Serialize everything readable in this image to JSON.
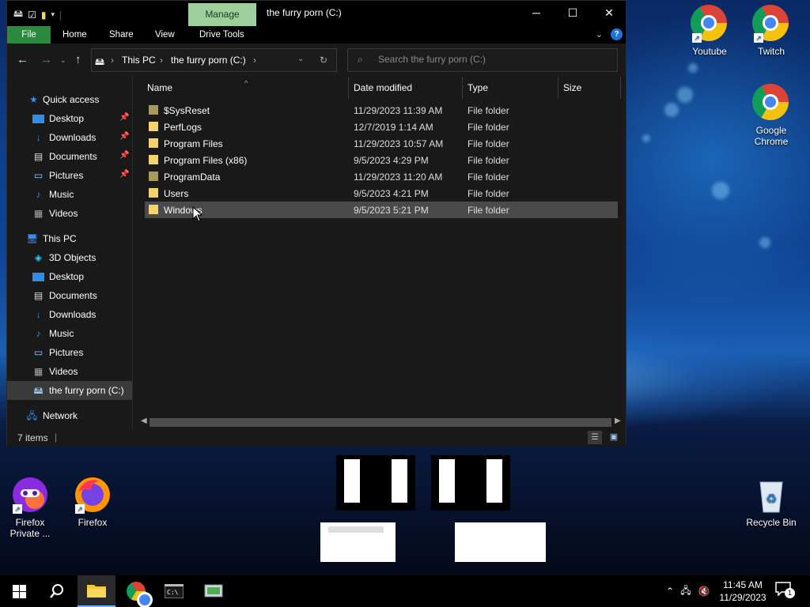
{
  "window": {
    "title": "the furry porn (C:)",
    "manage_label": "Manage",
    "tabs": [
      "File",
      "Home",
      "Share",
      "View",
      "Drive Tools"
    ]
  },
  "address": {
    "crumbs": [
      "This PC",
      "the furry porn (C:)"
    ],
    "search_placeholder": "Search the furry porn (C:)"
  },
  "nav": {
    "quick_access": "Quick access",
    "quick_items": [
      "Desktop",
      "Downloads",
      "Documents",
      "Pictures",
      "Music",
      "Videos"
    ],
    "this_pc": "This PC",
    "pc_items": [
      "3D Objects",
      "Desktop",
      "Documents",
      "Downloads",
      "Music",
      "Pictures",
      "Videos",
      "the furry porn (C:)"
    ],
    "network": "Network"
  },
  "columns": [
    "Name",
    "Date modified",
    "Type",
    "Size"
  ],
  "files": [
    {
      "name": "$SysReset",
      "date": "11/29/2023 11:39 AM",
      "type": "File folder"
    },
    {
      "name": "PerfLogs",
      "date": "12/7/2019 1:14 AM",
      "type": "File folder"
    },
    {
      "name": "Program Files",
      "date": "11/29/2023 10:57 AM",
      "type": "File folder"
    },
    {
      "name": "Program Files (x86)",
      "date": "9/5/2023 4:29 PM",
      "type": "File folder"
    },
    {
      "name": "ProgramData",
      "date": "11/29/2023 11:20 AM",
      "type": "File folder"
    },
    {
      "name": "Users",
      "date": "9/5/2023 4:21 PM",
      "type": "File folder"
    },
    {
      "name": "Windows",
      "date": "9/5/2023 5:21 PM",
      "type": "File folder"
    }
  ],
  "status": {
    "items_count": "7 items"
  },
  "desktop_icons": {
    "youtube": "Youtube",
    "twitch": "Twitch",
    "chrome": "Google Chrome",
    "firefox_private": "Firefox Private ...",
    "firefox": "Firefox",
    "recycle": "Recycle Bin"
  },
  "taskbar": {
    "time": "11:45 AM",
    "date": "11/29/2023",
    "notif_count": "1"
  },
  "colors": {
    "accent_green": "#2b8a3e",
    "manage_tab": "#9ed09d",
    "folder": "#f3d36b"
  }
}
